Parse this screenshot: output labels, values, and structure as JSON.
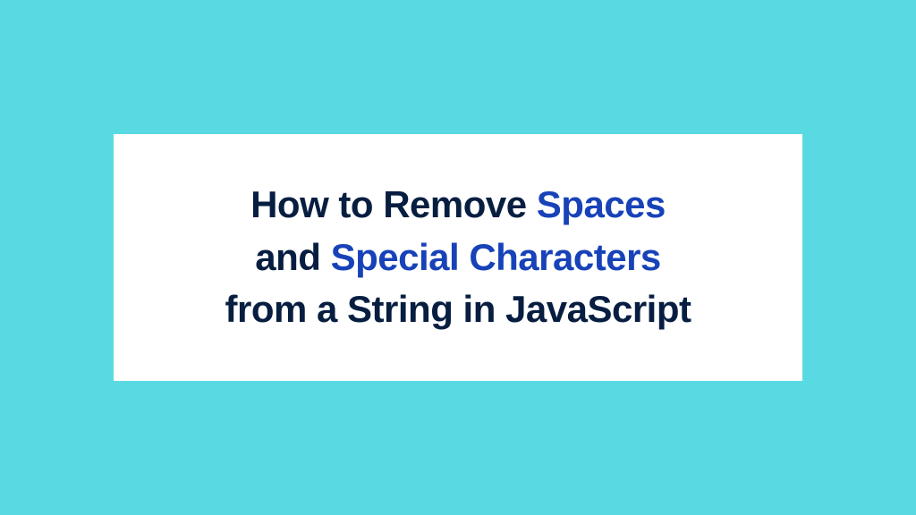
{
  "colors": {
    "background": "#59dae3",
    "card": "#ffffff",
    "textPrimary": "#071e40",
    "textHighlight": "#1742b8"
  },
  "heading": {
    "part1": "How to Remove ",
    "highlight1": "Spaces",
    "part2": " and ",
    "highlight2": "Special Characters",
    "part3": " from a String in JavaScript"
  }
}
